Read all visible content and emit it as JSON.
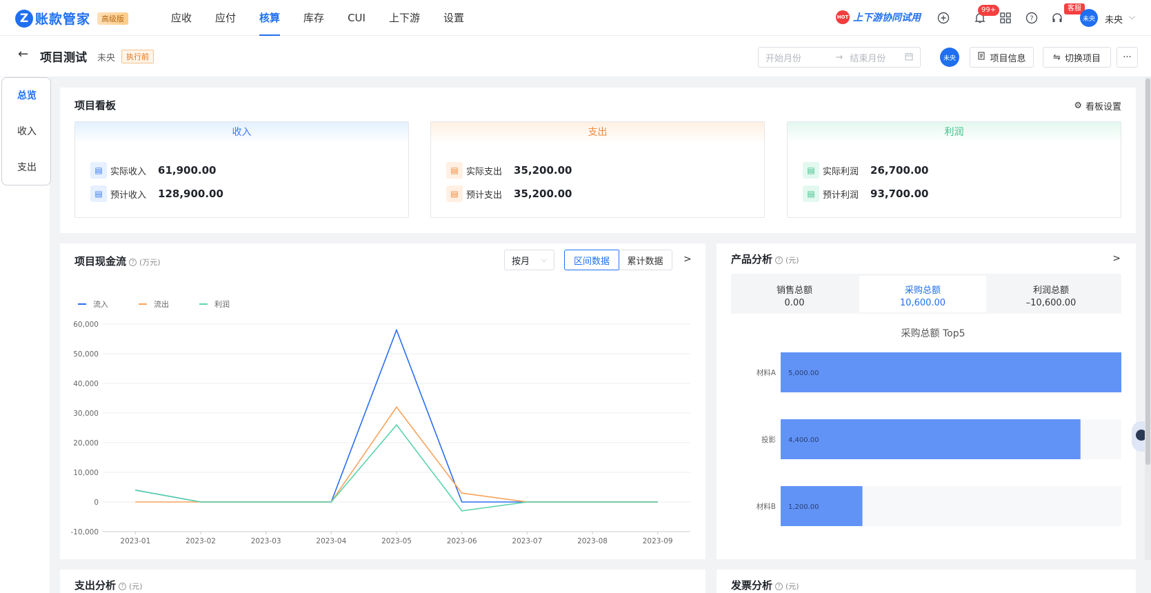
{
  "app": {
    "name": "账款管家",
    "edition": "高级版"
  },
  "nav": {
    "items": [
      "应收",
      "应付",
      "核算",
      "库存",
      "CUI",
      "上下游",
      "设置"
    ],
    "active_index": 2,
    "hot_link": "上下游协同试用",
    "hot_tag": "HOT",
    "notify_count": "99+",
    "service_badge": "客服",
    "user": "未央"
  },
  "project": {
    "title": "项目测试",
    "owner": "未央",
    "status": "执行前",
    "start_placeholder": "开始月份",
    "end_placeholder": "结束月份",
    "avatar": "未央",
    "info_button": "项目信息",
    "switch_button": "切换项目",
    "more_button": "···"
  },
  "sidebar": {
    "tabs": [
      "总览",
      "收入",
      "支出"
    ],
    "active_index": 0
  },
  "board": {
    "title": "项目看板",
    "settings": "看板设置",
    "income": {
      "title": "收入",
      "actual_label": "实际收入",
      "actual_value": "61,900.00",
      "planned_label": "预计收入",
      "planned_value": "128,900.00"
    },
    "expense": {
      "title": "支出",
      "actual_label": "实际支出",
      "actual_value": "35,200.00",
      "planned_label": "预计支出",
      "planned_value": "35,200.00"
    },
    "profit": {
      "title": "利润",
      "actual_label": "实际利润",
      "actual_value": "26,700.00",
      "planned_label": "预计利润",
      "planned_value": "93,700.00"
    }
  },
  "cashflow": {
    "title": "项目现金流",
    "unit": "(万元)",
    "period_select": "按月",
    "btn_range": "区间数据",
    "btn_cumulative": "累计数据",
    "next": ">"
  },
  "product": {
    "title": "产品分析",
    "unit": "(元)",
    "next": ">",
    "stats": [
      {
        "label": "销售总额",
        "value": "0.00"
      },
      {
        "label": "采购总额",
        "value": "10,600.00"
      },
      {
        "label": "利润总额",
        "value": "–10,600.00"
      }
    ],
    "selected_stat": 1
  },
  "expense_analysis": {
    "title": "支出分析",
    "unit": "(元)"
  },
  "invoice_analysis": {
    "title": "发票分析",
    "unit": "(元)"
  },
  "colors": {
    "primary": "#1f6ff0",
    "inflow": "#2b6cf0",
    "outflow": "#f7a35c",
    "profit": "#5bd4a8",
    "bar": "#6193f7"
  },
  "chart_data": [
    {
      "type": "line",
      "x": [
        "2023-01",
        "2023-02",
        "2023-03",
        "2023-04",
        "2023-05",
        "2023-06",
        "2023-07",
        "2023-08",
        "2023-09"
      ],
      "series": [
        {
          "name": "流入",
          "values": [
            4000,
            0,
            0,
            0,
            58000,
            0,
            0,
            0,
            0
          ]
        },
        {
          "name": "流出",
          "values": [
            0,
            0,
            0,
            0,
            32000,
            3000,
            0,
            0,
            0
          ]
        },
        {
          "name": "利润",
          "values": [
            4000,
            0,
            0,
            0,
            26000,
            -3000,
            0,
            0,
            0
          ]
        }
      ],
      "yticks": [
        "60,000",
        "50,000",
        "40,000",
        "30,000",
        "20,000",
        "10,000",
        "0",
        "-10,000"
      ],
      "ylim": [
        -10000,
        60000
      ],
      "grid": true,
      "legend": "top-left"
    },
    {
      "type": "bar",
      "orientation": "horizontal",
      "title": "采购总额 Top5",
      "categories": [
        "材料A",
        "投影",
        "材料B"
      ],
      "values": [
        5000,
        4400,
        1200
      ],
      "labels": [
        "5,000.00",
        "4,400.00",
        "1,200.00"
      ],
      "xlim": [
        0,
        5000
      ]
    }
  ]
}
